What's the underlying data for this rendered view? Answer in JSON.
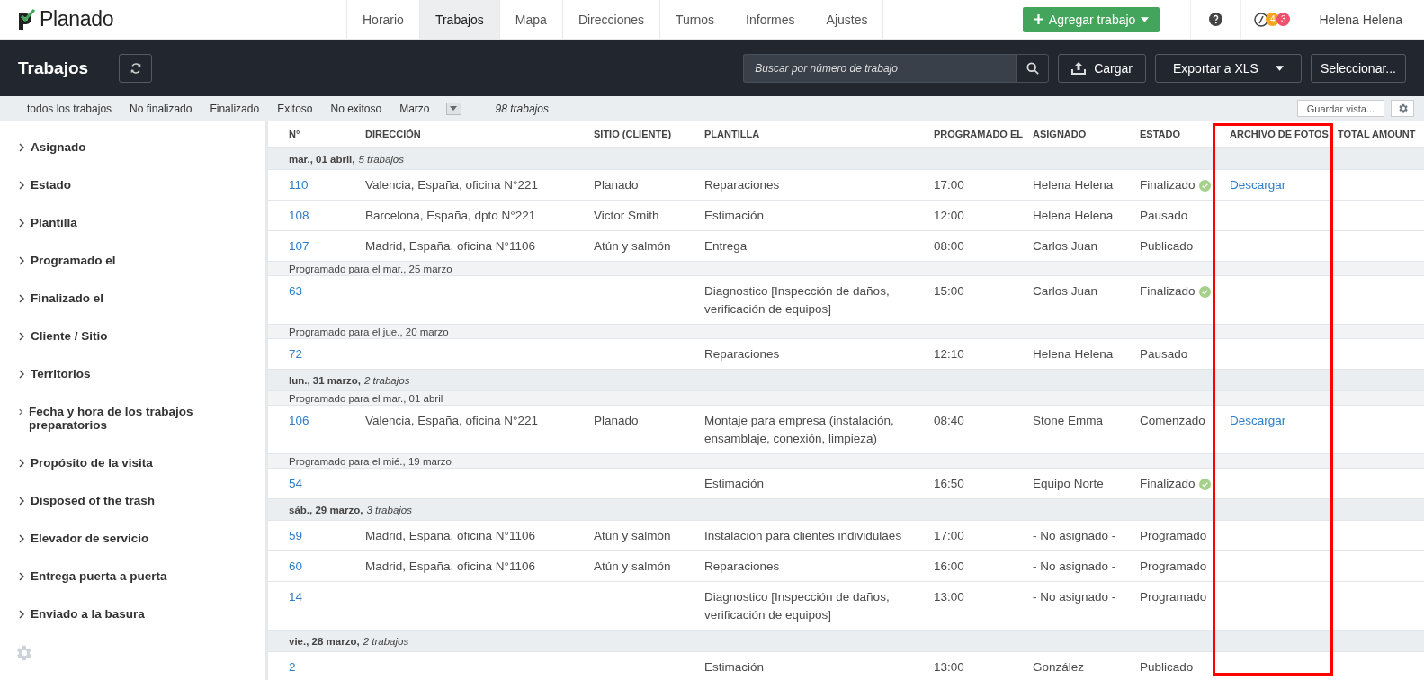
{
  "brand": "Planado",
  "nav": [
    {
      "label": "Horario",
      "selected": false
    },
    {
      "label": "Trabajos",
      "selected": true
    },
    {
      "label": "Mapa",
      "selected": false
    },
    {
      "label": "Direcciones",
      "selected": false
    },
    {
      "label": "Turnos",
      "selected": false
    },
    {
      "label": "Informes",
      "selected": false
    },
    {
      "label": "Ajustes",
      "selected": false
    }
  ],
  "add_button": "Agregar trabajo",
  "badges": [
    {
      "count": "4",
      "color": "#f5a623"
    },
    {
      "count": "3",
      "color": "#f0506e"
    }
  ],
  "user": "Helena Helena",
  "toolbar": {
    "title": "Trabajos",
    "search_placeholder": "Buscar por número de trabajo",
    "upload": "Cargar",
    "export": "Exportar a XLS",
    "select": "Seleccionar..."
  },
  "filters": [
    {
      "label": "todos los trabajos"
    },
    {
      "label": "No finalizado"
    },
    {
      "label": "Finalizado"
    },
    {
      "label": "Exitoso"
    },
    {
      "label": "No exitoso"
    },
    {
      "label": "Marzo"
    }
  ],
  "job_count": "98 trabajos",
  "save_view": "Guardar vista...",
  "sidebar": [
    {
      "label": "Asignado",
      "expanded": false
    },
    {
      "label": "Estado",
      "expanded": false
    },
    {
      "label": "Plantilla",
      "expanded": false
    },
    {
      "label": "Programado el",
      "expanded": false
    },
    {
      "label": "Finalizado el",
      "expanded": false
    },
    {
      "label": "Cliente / Sitio",
      "expanded": false
    },
    {
      "label": "Territorios",
      "expanded": false
    },
    {
      "label": "Fecha y hora de los trabajos preparatorios",
      "expanded": false
    },
    {
      "label": "Propósito de la visita",
      "expanded": false
    },
    {
      "label": "Disposed of the trash",
      "expanded": false
    },
    {
      "label": "Elevador de servicio",
      "expanded": false
    },
    {
      "label": "Entrega puerta a puerta",
      "expanded": false
    },
    {
      "label": "Enviado a la basura",
      "expanded": false
    }
  ],
  "table": {
    "columns": [
      {
        "label": "N°",
        "highlighted": false
      },
      {
        "label": "DIRECCIÓN",
        "highlighted": false
      },
      {
        "label": "SITIO (CLIENTE)",
        "highlighted": false
      },
      {
        "label": "PLANTILLA",
        "highlighted": false
      },
      {
        "label": "PROGRAMADO EL",
        "highlighted": false
      },
      {
        "label": "ASIGNADO",
        "highlighted": false
      },
      {
        "label": "ESTADO",
        "highlighted": false
      },
      {
        "label": "ARCHIVO DE FOTOS",
        "highlighted": true
      },
      {
        "label": "TOTAL AMOUNT",
        "highlighted": false
      }
    ],
    "rows": [
      {
        "kind": "day",
        "date": "mar., 01 abril,",
        "count": "5 trabajos"
      },
      {
        "kind": "job",
        "number": "110",
        "address": "Valencia, España, oficina N°221",
        "site": "Planado",
        "template": "Reparaciones",
        "time": "17:00",
        "assignee": "Helena Helena",
        "status": "Finalizado",
        "done": true,
        "photos": "Descargar"
      },
      {
        "kind": "job",
        "number": "108",
        "address": "Barcelona, España, dpto N°221",
        "site": "Victor Smith",
        "template": "Estimación",
        "time": "12:00",
        "assignee": "Helena Helena",
        "status": "Pausado",
        "done": false
      },
      {
        "kind": "job",
        "number": "107",
        "address": "Madrid, España, oficina N°1106",
        "site": "Atún y salmón",
        "template": "Entrega",
        "time": "08:00",
        "assignee": "Carlos Juan",
        "status": "Publicado",
        "done": false
      },
      {
        "kind": "scheduled",
        "text": "Programado para el mar., 25 marzo"
      },
      {
        "kind": "job",
        "number": "63",
        "template": "Diagnostico [Inspección de daños, verificación de equipos]",
        "time": "15:00",
        "assignee": "Carlos Juan",
        "status": "Finalizado",
        "done": true
      },
      {
        "kind": "scheduled",
        "text": "Programado para el jue., 20 marzo"
      },
      {
        "kind": "job",
        "number": "72",
        "template": "Reparaciones",
        "time": "12:10",
        "assignee": "Helena Helena",
        "status": "Pausado",
        "done": false
      },
      {
        "kind": "day",
        "date": "lun., 31 marzo,",
        "count": "2 trabajos"
      },
      {
        "kind": "scheduled",
        "text": "Programado para el mar., 01 abril"
      },
      {
        "kind": "job",
        "number": "106",
        "address": "Valencia, España, oficina N°221",
        "site": "Planado",
        "template": "Montaje para empresa (instalación, ensamblaje, conexión, limpieza)",
        "time": "08:40",
        "assignee": "Stone Emma",
        "status": "Comenzado",
        "done": false,
        "photos": "Descargar"
      },
      {
        "kind": "scheduled",
        "text": "Programado para el mié., 19 marzo"
      },
      {
        "kind": "job",
        "number": "54",
        "template": "Estimación",
        "time": "16:50",
        "assignee": "Equipo Norte",
        "status": "Finalizado",
        "done": true
      },
      {
        "kind": "day",
        "date": "sáb., 29 marzo,",
        "count": "3 trabajos"
      },
      {
        "kind": "job",
        "number": "59",
        "address": "Madrid, España, oficina N°1106",
        "site": "Atún y salmón",
        "template": "Instalación para clientes individulaes",
        "time": "17:00",
        "assignee": "- No asignado -",
        "status": "Programado",
        "done": false
      },
      {
        "kind": "job",
        "number": "60",
        "address": "Madrid, España, oficina N°1106",
        "site": "Atún y salmón",
        "template": "Reparaciones",
        "time": "16:00",
        "assignee": "- No asignado -",
        "status": "Programado",
        "done": false
      },
      {
        "kind": "job",
        "number": "14",
        "template": "Diagnostico [Inspección de daños, verificación de equipos]",
        "time": "13:00",
        "assignee": "- No asignado -",
        "status": "Programado",
        "done": false
      },
      {
        "kind": "day",
        "date": "vie., 28 marzo,",
        "count": "2 trabajos"
      },
      {
        "kind": "job",
        "number": "2",
        "template": "Estimación",
        "time": "13:00",
        "assignee": "González",
        "status": "Publicado",
        "done": false
      }
    ]
  }
}
